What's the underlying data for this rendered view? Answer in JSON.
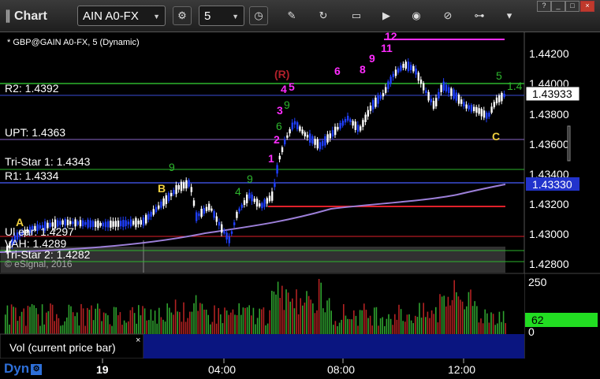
{
  "toolbar": {
    "title": "Chart",
    "symbol": "AIN A0-FX",
    "interval": "5",
    "icons": [
      "gear-icon",
      "clock-icon",
      "pencil-icon",
      "refresh-icon",
      "edit-icon",
      "play-icon",
      "alert-icon",
      "link-icon",
      "pin-icon",
      "filter-icon"
    ]
  },
  "chart": {
    "subtitle": "* GBP@GAIN A0-FX, 5 (Dynamic)",
    "copyright": "© eSignal, 2016",
    "level_labels": {
      "r2": "R2: 1.4392",
      "upt": "UPT: 1.4363",
      "tristar1": "Tri-Star 1: 1.4343",
      "r1": "R1: 1.4334",
      "ultra": "Ul ear: 1.4297",
      "vah": "VAH: 1.4289",
      "tristar2": "Tri-Star 2: 1.4282"
    },
    "price_ticks": [
      "1.44200",
      "1.44000",
      "1.43800",
      "1.43600",
      "1.43400",
      "1.43200",
      "1.43000",
      "1.42800"
    ],
    "last_price_badge": "1.43933",
    "r1_badge": "1.43330",
    "markers": {
      "a": "A",
      "b": "B",
      "c": "C",
      "r": "(R)",
      "magenta_counts": [
        "1",
        "2",
        "3",
        "4",
        "5",
        "6",
        "8",
        "9",
        "11",
        "12"
      ],
      "green_counts": [
        "9",
        "4",
        "9",
        "6",
        "5",
        "9",
        "1.4"
      ]
    },
    "time_ticks": [
      "19",
      "04:00",
      "08:00",
      "12:00"
    ],
    "colors": {
      "background": "#000000",
      "candles_up": "#ffffff",
      "candles_down": "#1f3fff",
      "r2_line": "#2db52d",
      "pivot_blue": "#3a4dd6",
      "red_line": "#e0202a",
      "purple_ma": "#9c7fd8",
      "magenta": "#ff2cff",
      "volume_up": "#2fa22f",
      "volume_down": "#b22222",
      "badge_green": "#22dd22"
    }
  },
  "volume": {
    "label": "Vol (current price bar)",
    "close": "×",
    "ticks": [
      "250",
      "0"
    ],
    "current_value_badge": "62"
  },
  "footer": {
    "mode": "Dyn"
  }
}
